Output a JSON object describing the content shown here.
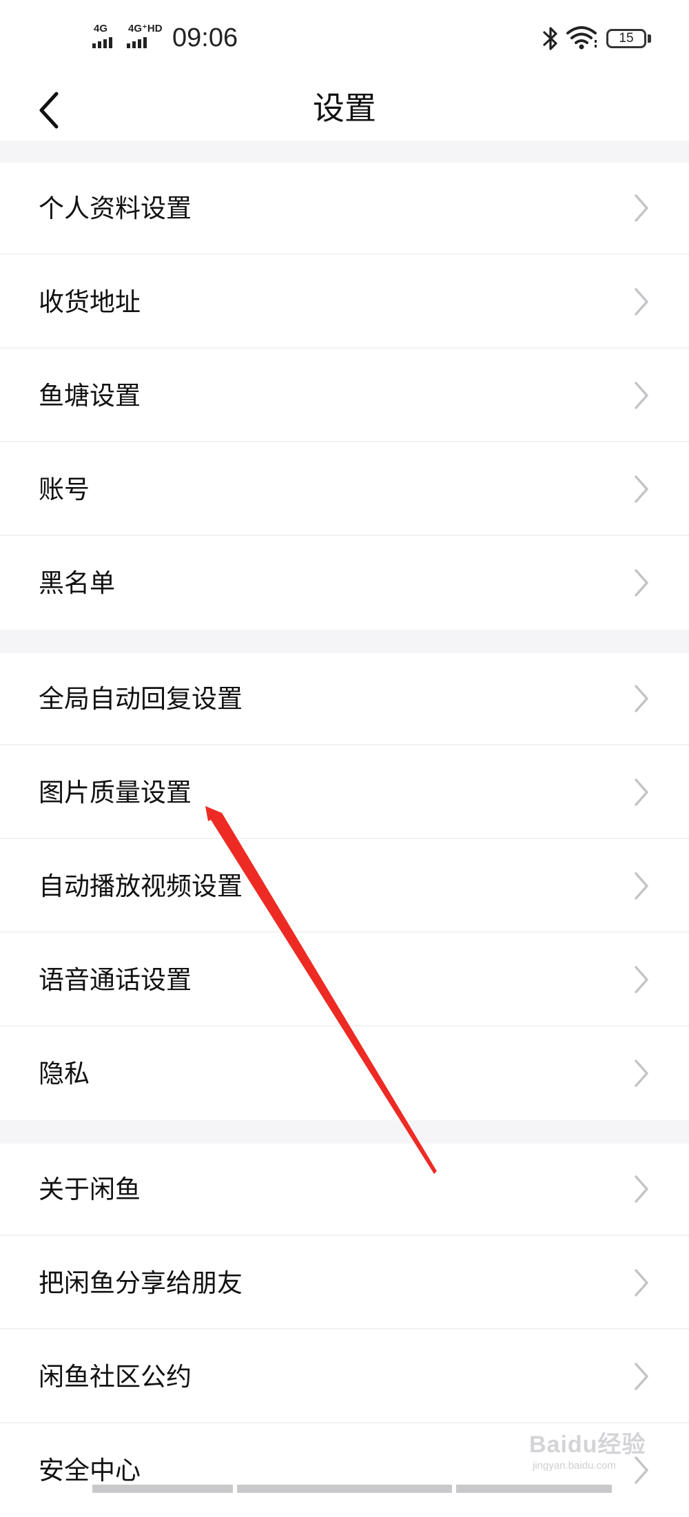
{
  "status_bar": {
    "signal1": "4G",
    "signal2": "4G⁺HD",
    "time": "09:06",
    "battery": "15",
    "icons": [
      "signal-icon",
      "signal-icon",
      "bluetooth-icon",
      "wifi-icon",
      "battery-icon"
    ]
  },
  "header": {
    "title": "设置",
    "back_icon": "chevron-left-icon"
  },
  "groups": [
    {
      "items": [
        {
          "label": "个人资料设置"
        },
        {
          "label": "收货地址"
        },
        {
          "label": "鱼塘设置"
        },
        {
          "label": "账号"
        },
        {
          "label": "黑名单"
        }
      ]
    },
    {
      "items": [
        {
          "label": "全局自动回复设置"
        },
        {
          "label": "图片质量设置"
        },
        {
          "label": "自动播放视频设置"
        },
        {
          "label": "语音通话设置"
        },
        {
          "label": "隐私"
        }
      ]
    },
    {
      "items": [
        {
          "label": "关于闲鱼"
        },
        {
          "label": "把闲鱼分享给朋友"
        },
        {
          "label": "闲鱼社区公约"
        },
        {
          "label": "安全中心"
        }
      ]
    }
  ],
  "watermark": {
    "text": "Baidu经验",
    "sub": "jingyan.baidu.com"
  },
  "colors": {
    "background": "#ffffff",
    "section_gap": "#f5f5f7",
    "chevron": "#c4c4c8",
    "annotation_arrow": "#ee2a24"
  }
}
